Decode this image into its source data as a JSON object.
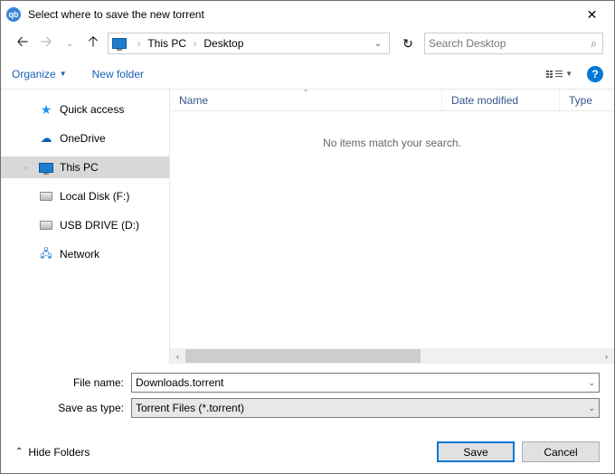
{
  "window": {
    "title": "Select where to save the new torrent",
    "app_icon_text": "qb"
  },
  "nav": {
    "back_enabled": true,
    "forward_enabled": false,
    "up_enabled": true,
    "crumbs": [
      "This PC",
      "Desktop"
    ],
    "refresh_glyph": "↻"
  },
  "search": {
    "placeholder": "Search Desktop",
    "value": ""
  },
  "toolbar": {
    "organize": "Organize",
    "new_folder": "New folder"
  },
  "sidebar": [
    {
      "icon": "star",
      "label": "Quick access",
      "selected": false,
      "chev": false
    },
    {
      "icon": "cloud",
      "label": "OneDrive",
      "selected": false,
      "chev": false
    },
    {
      "icon": "pc",
      "label": "This PC",
      "selected": true,
      "chev": true
    },
    {
      "icon": "disk",
      "label": "Local Disk (F:)",
      "selected": false,
      "chev": false
    },
    {
      "icon": "usb",
      "label": "USB DRIVE (D:)",
      "selected": false,
      "chev": false
    },
    {
      "icon": "net",
      "label": "Network",
      "selected": false,
      "chev": false
    }
  ],
  "columns": {
    "name": "Name",
    "date": "Date modified",
    "type": "Type"
  },
  "empty_text": "No items match your search.",
  "filename": {
    "label": "File name:",
    "value": "Downloads.torrent"
  },
  "filetype": {
    "label": "Save as type:",
    "value": "Torrent Files (*.torrent)"
  },
  "footer": {
    "hide_folders": "Hide Folders",
    "save": "Save",
    "cancel": "Cancel"
  }
}
